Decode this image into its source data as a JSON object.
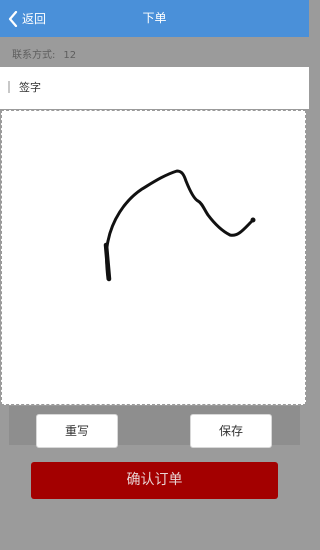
{
  "header": {
    "back_label": "返回",
    "title": "下单",
    "icon": "chevron-left-icon",
    "background_color": "#4a90d9"
  },
  "contact": {
    "label": "联系方式:",
    "value": "12"
  },
  "signature": {
    "section_label": "签字"
  },
  "buttons": {
    "redo_label": "重写",
    "save_label": "保存",
    "confirm_label": "确认订单",
    "confirm_color": "#a30000"
  }
}
